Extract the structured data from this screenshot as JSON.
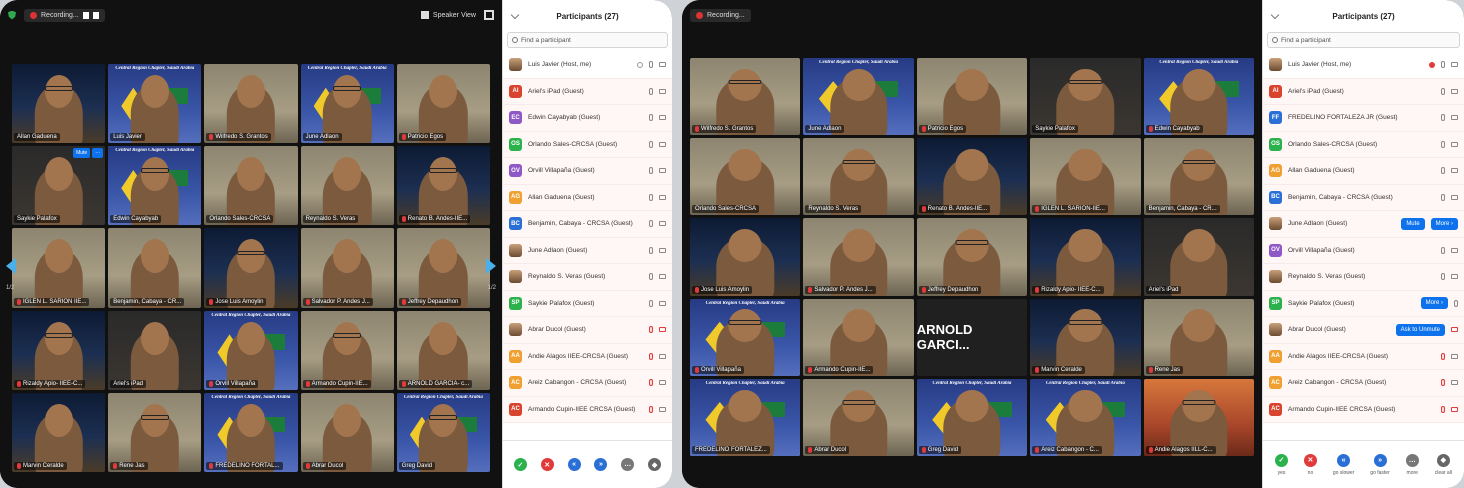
{
  "left": {
    "recording_label": "Recording...",
    "speaker_view_label": "Speaker View",
    "page_label": "1/2",
    "tile_buttons": [
      "Mute",
      "···"
    ],
    "banner_text": "Central Region Chapter, Saudi Arabia",
    "participants_title": "Participants (27)",
    "search_placeholder": "Find a participant",
    "tiles": [
      {
        "name": "Allan Gaduena",
        "kind": "night"
      },
      {
        "name": "Luis Javier",
        "kind": "banner"
      },
      {
        "name": "Wilfredo S. Grantos",
        "kind": "room",
        "muted": true
      },
      {
        "name": "June Adlaon",
        "kind": "banner"
      },
      {
        "name": "Patricio Egos",
        "kind": "room",
        "muted": true
      },
      {
        "name": "Saykie Palafox",
        "kind": "dark",
        "buttons": true
      },
      {
        "name": "Edwin Cayabyab",
        "kind": "banner",
        "active": true
      },
      {
        "name": "Orlando Sales-CRCSA",
        "kind": "room"
      },
      {
        "name": "Reynaldo S. Veras",
        "kind": "room"
      },
      {
        "name": "Renato B. Andes-IIE...",
        "kind": "night",
        "muted": true
      },
      {
        "name": "IGLEN L. SARION IIE...",
        "kind": "room",
        "muted": true
      },
      {
        "name": "Benjamin, Cabaya - CR...",
        "kind": "room"
      },
      {
        "name": "Jose Luis Amoylin",
        "kind": "night",
        "muted": true
      },
      {
        "name": "Salvador P. Andes J...",
        "kind": "room",
        "muted": true
      },
      {
        "name": "Jeffrey Depaudhon",
        "kind": "room",
        "muted": true
      },
      {
        "name": "Rizaldy Apio- IIEE-C...",
        "kind": "night",
        "muted": true
      },
      {
        "name": "Ariel's iPad",
        "kind": "dark"
      },
      {
        "name": "Orvill Villapaña",
        "kind": "banner",
        "muted": true
      },
      {
        "name": "Armando Cupin-IIE...",
        "kind": "room",
        "muted": true
      },
      {
        "name": "ARNOLD GARCIA- c...",
        "kind": "room",
        "muted": true
      },
      {
        "name": "Marvin Ceralde",
        "kind": "night",
        "muted": true
      },
      {
        "name": "Rene Jas",
        "kind": "room",
        "muted": true
      },
      {
        "name": "FREDELINO FORTAL...",
        "kind": "banner",
        "muted": true
      },
      {
        "name": "Abrar Ducol",
        "kind": "room",
        "muted": true
      },
      {
        "name": "Greg David",
        "kind": "banner"
      }
    ],
    "participants": [
      {
        "name": "Luis Javier (Host, me)",
        "avatar": "photo",
        "color": "",
        "mic": "on",
        "video": "on",
        "me": true
      },
      {
        "name": "Ariel's iPad (Guest)",
        "avatar": "AI",
        "color": "#d9442e",
        "mic": "on",
        "video": "on"
      },
      {
        "name": "Edwin Cayabyab (Guest)",
        "avatar": "EC",
        "color": "#8f58c7",
        "mic": "on",
        "video": "on"
      },
      {
        "name": "Orlando Sales-CRCSA (Guest)",
        "avatar": "OS",
        "color": "#2bb24c",
        "mic": "on",
        "video": "on"
      },
      {
        "name": "Orvill Villapaña (Guest)",
        "avatar": "OV",
        "color": "#8f58c7",
        "mic": "on",
        "video": "on"
      },
      {
        "name": "Allan Gaduena (Guest)",
        "avatar": "AG",
        "color": "#f0a030",
        "mic": "on",
        "video": "on"
      },
      {
        "name": "Benjamin, Cabaya - CRCSA (Guest)",
        "avatar": "BC",
        "color": "#2a6fd6",
        "mic": "on",
        "video": "on"
      },
      {
        "name": "June Adlaon (Guest)",
        "avatar": "photo",
        "color": "",
        "mic": "on",
        "video": "on"
      },
      {
        "name": "Reynaldo S. Veras (Guest)",
        "avatar": "photo",
        "color": "",
        "mic": "on",
        "video": "on"
      },
      {
        "name": "Saykie Palafox (Guest)",
        "avatar": "SP",
        "color": "#2bb24c",
        "mic": "on",
        "video": "on"
      },
      {
        "name": "Abrar Ducol (Guest)",
        "avatar": "photo",
        "color": "",
        "mic": "off",
        "video": "off"
      },
      {
        "name": "Andie Alagos IIEE-CRCSA (Guest)",
        "avatar": "AA",
        "color": "#f0a030",
        "mic": "off",
        "video": "on"
      },
      {
        "name": "Areiz Cabangon - CRCSA (Guest)",
        "avatar": "AC",
        "color": "#f0a030",
        "mic": "off",
        "video": "on"
      },
      {
        "name": "Armando Cupin-IIEE CRCSA (Guest)",
        "avatar": "AC",
        "color": "#d9442e",
        "mic": "off",
        "video": "on"
      }
    ]
  },
  "right": {
    "recording_label": "Recording...",
    "banner_text": "Central Region Chapter, Saudi Arabia",
    "participants_title": "Participants (27)",
    "search_placeholder": "Find a participant",
    "tiles": [
      {
        "name": "Wilfredo S. Grantos",
        "kind": "room",
        "muted": true
      },
      {
        "name": "June Adlaon",
        "kind": "banner"
      },
      {
        "name": "Patricio Egos",
        "kind": "room",
        "muted": true
      },
      {
        "name": "Saykie Palafox",
        "kind": "dark"
      },
      {
        "name": "Edwin Cayabyab",
        "kind": "banner",
        "muted": true
      },
      {
        "name": "Orlando Sales-CRCSA",
        "kind": "room"
      },
      {
        "name": "Reynaldo S. Veras",
        "kind": "room"
      },
      {
        "name": "Renato B. Andes-IIE...",
        "kind": "night",
        "muted": true
      },
      {
        "name": "IGLEN L. SARION-IIE...",
        "kind": "room",
        "muted": true
      },
      {
        "name": "Benjamin, Cabaya - CR...",
        "kind": "room"
      },
      {
        "name": "Jose Luis Amoylin",
        "kind": "night",
        "muted": true
      },
      {
        "name": "Salvador P. Andes J...",
        "kind": "room",
        "muted": true
      },
      {
        "name": "Jeffrey Depaudhon",
        "kind": "room",
        "muted": true
      },
      {
        "name": "Rizaldy Apio- IIEE-C...",
        "kind": "night",
        "muted": true
      },
      {
        "name": "Ariel's iPad",
        "kind": "dark"
      },
      {
        "name": "Orvill Villapaña",
        "kind": "banner",
        "muted": true
      },
      {
        "name": "Armando Cupin-IIE...",
        "kind": "room",
        "muted": true
      },
      {
        "name": "ARNOLD GARCI...",
        "kind": "text"
      },
      {
        "name": "Marvin Ceralde",
        "kind": "night",
        "muted": true
      },
      {
        "name": "Rene Jas",
        "kind": "room",
        "muted": true
      },
      {
        "name": "FREDELINO FORTALEZ...",
        "kind": "banner",
        "active": true
      },
      {
        "name": "Abrar Ducol",
        "kind": "room",
        "muted": true
      },
      {
        "name": "Greg David",
        "kind": "banner",
        "muted": true
      },
      {
        "name": "Areiz Cabangon - C...",
        "kind": "banner",
        "muted": true
      },
      {
        "name": "Andie Alagos IILL-C...",
        "kind": "desert",
        "muted": true
      }
    ],
    "participants": [
      {
        "name": "Luis Javier (Host, me)",
        "avatar": "photo",
        "color": "",
        "mic": "on",
        "video": "on",
        "me": true,
        "rec": true
      },
      {
        "name": "Ariel's iPad (Guest)",
        "avatar": "AI",
        "color": "#d9442e",
        "mic": "on",
        "video": "on"
      },
      {
        "name": "FREDELINO FORTALEZA JR (Guest)",
        "avatar": "FF",
        "color": "#2a6fd6",
        "mic": "on",
        "video": "on"
      },
      {
        "name": "Orlando Sales-CRCSA (Guest)",
        "avatar": "OS",
        "color": "#2bb24c",
        "mic": "on",
        "video": "on"
      },
      {
        "name": "Allan Gaduena (Guest)",
        "avatar": "AG",
        "color": "#f0a030",
        "mic": "on",
        "video": "on"
      },
      {
        "name": "Benjamin, Cabaya - CRCSA (Guest)",
        "avatar": "BC",
        "color": "#2a6fd6",
        "mic": "on",
        "video": "on"
      },
      {
        "name": "June Adlaon (Guest)",
        "avatar": "photo",
        "color": "",
        "buttons": [
          "Mute",
          "More ›"
        ]
      },
      {
        "name": "Orvill Villapaña (Guest)",
        "avatar": "OV",
        "color": "#8f58c7",
        "mic": "on",
        "video": "on"
      },
      {
        "name": "Reynaldo S. Veras (Guest)",
        "avatar": "photo",
        "color": "",
        "mic": "on",
        "video": "on"
      },
      {
        "name": "Saykie Palafox (Guest)",
        "avatar": "SP",
        "color": "#2bb24c",
        "buttons": [
          "More ›"
        ],
        "mic": "on"
      },
      {
        "name": "Abrar Ducol (Guest)",
        "avatar": "photo",
        "color": "",
        "buttons": [
          "Ask to Unmute"
        ],
        "video": "off"
      },
      {
        "name": "Andie Alagos IIEE-CRCSA (Guest)",
        "avatar": "AA",
        "color": "#f0a030",
        "mic": "off",
        "video": "on"
      },
      {
        "name": "Areiz Cabangon - CRCSA (Guest)",
        "avatar": "AC",
        "color": "#f0a030",
        "mic": "off",
        "video": "on"
      },
      {
        "name": "Armando Cupin-IIEE CRCSA (Guest)",
        "avatar": "AC",
        "color": "#d9442e",
        "mic": "off",
        "video": "off"
      }
    ],
    "footer": [
      {
        "label": "yes",
        "color": "#2bb24c",
        "glyph": "✓"
      },
      {
        "label": "no",
        "color": "#e03a3a",
        "glyph": "✕"
      },
      {
        "label": "go slower",
        "color": "#2a6fd6",
        "glyph": "«"
      },
      {
        "label": "go faster",
        "color": "#2a6fd6",
        "glyph": "»"
      },
      {
        "label": "more",
        "color": "#777777",
        "glyph": "…"
      },
      {
        "label": "clear all",
        "color": "#666666",
        "glyph": "◆"
      }
    ]
  }
}
